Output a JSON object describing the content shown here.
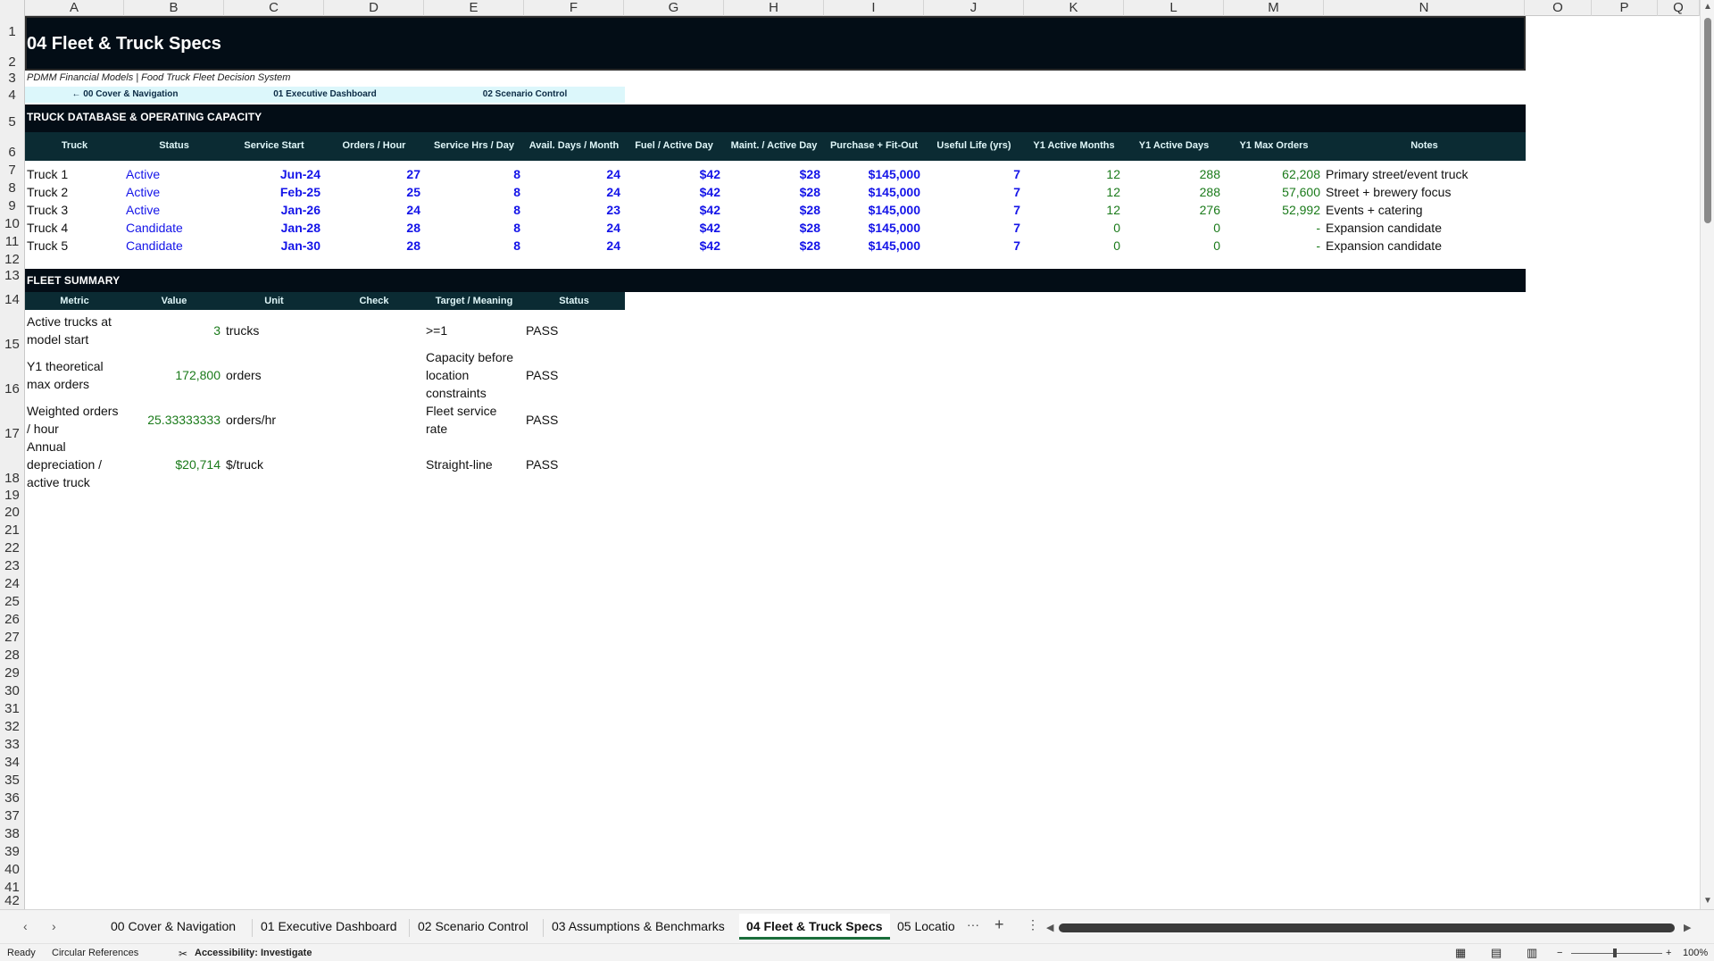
{
  "columns": [
    "A",
    "B",
    "C",
    "D",
    "E",
    "F",
    "G",
    "H",
    "I",
    "J",
    "K",
    "L",
    "M",
    "N",
    "O",
    "P",
    "Q"
  ],
  "rows": [
    "1",
    "2",
    "3",
    "4",
    "5",
    "6",
    "7",
    "8",
    "9",
    "10",
    "11",
    "12",
    "13",
    "14",
    "15",
    "16",
    "17",
    "18",
    "19",
    "20",
    "21",
    "22",
    "23",
    "24",
    "25",
    "26",
    "27",
    "28",
    "29",
    "30",
    "31",
    "32",
    "33",
    "34",
    "35",
    "36",
    "37",
    "38",
    "39",
    "40",
    "41",
    "42"
  ],
  "title": "04 Fleet & Truck Specs",
  "subtitle": "PDMM Financial Models | Food Truck Fleet Decision System",
  "nav": {
    "back": "← 00 Cover & Navigation",
    "dashboard": "01 Executive Dashboard",
    "scenario": "02 Scenario Control"
  },
  "truck_section": {
    "header": "TRUCK DATABASE & OPERATING CAPACITY",
    "columns": [
      "Truck",
      "Status",
      "Service Start",
      "Orders / Hour",
      "Service Hrs / Day",
      "Avail. Days / Month",
      "Fuel / Active Day",
      "Maint. / Active Day",
      "Purchase + Fit-Out",
      "Useful Life (yrs)",
      "Y1 Active Months",
      "Y1 Active Days",
      "Y1 Max Orders",
      "Notes"
    ],
    "rows": [
      [
        "Truck 1",
        "Active",
        "Jun-24",
        "27",
        "8",
        "24",
        "$42",
        "$28",
        "$145,000",
        "7",
        "12",
        "288",
        "62,208",
        "Primary street/event truck"
      ],
      [
        "Truck 2",
        "Active",
        "Feb-25",
        "25",
        "8",
        "24",
        "$42",
        "$28",
        "$145,000",
        "7",
        "12",
        "288",
        "57,600",
        "Street + brewery focus"
      ],
      [
        "Truck 3",
        "Active",
        "Jan-26",
        "24",
        "8",
        "23",
        "$42",
        "$28",
        "$145,000",
        "7",
        "12",
        "276",
        "52,992",
        "Events + catering"
      ],
      [
        "Truck 4",
        "Candidate",
        "Jan-28",
        "28",
        "8",
        "24",
        "$42",
        "$28",
        "$145,000",
        "7",
        "0",
        "0",
        "-",
        "Expansion candidate"
      ],
      [
        "Truck 5",
        "Candidate",
        "Jan-30",
        "28",
        "8",
        "24",
        "$42",
        "$28",
        "$145,000",
        "7",
        "0",
        "0",
        "-",
        "Expansion candidate"
      ]
    ]
  },
  "summary_section": {
    "header": "FLEET SUMMARY",
    "columns": [
      "Metric",
      "Value",
      "Unit",
      "Check",
      "Target / Meaning",
      "Status"
    ],
    "rows": [
      {
        "metric": "Active trucks at model start",
        "value": "3",
        "unit": "trucks",
        "check": "",
        "target": ">=1",
        "status": "PASS"
      },
      {
        "metric": "Y1 theoretical max orders",
        "value": "172,800",
        "unit": "orders",
        "check": "",
        "target": "Capacity before location constraints",
        "status": "PASS"
      },
      {
        "metric": "Weighted orders / hour",
        "value": "25.33333333",
        "unit": "orders/hr",
        "check": "",
        "target": "Fleet service rate",
        "status": "PASS"
      },
      {
        "metric": "Annual depreciation / active truck",
        "value": "$20,714",
        "unit": "$/truck",
        "check": "",
        "target": "Straight-line",
        "status": "PASS"
      }
    ]
  },
  "tabs": [
    "00 Cover & Navigation",
    "01 Executive Dashboard",
    "02 Scenario Control",
    "03 Assumptions & Benchmarks",
    "04 Fleet & Truck Specs",
    "05 Locatio"
  ],
  "active_tab": "04 Fleet & Truck Specs",
  "tab_more": "···",
  "tab_add": "+",
  "tab_menu": "⋮",
  "status": {
    "ready": "Ready",
    "circular": "Circular References",
    "accessibility": "Accessibility: Investigate",
    "zoom": "100%"
  }
}
